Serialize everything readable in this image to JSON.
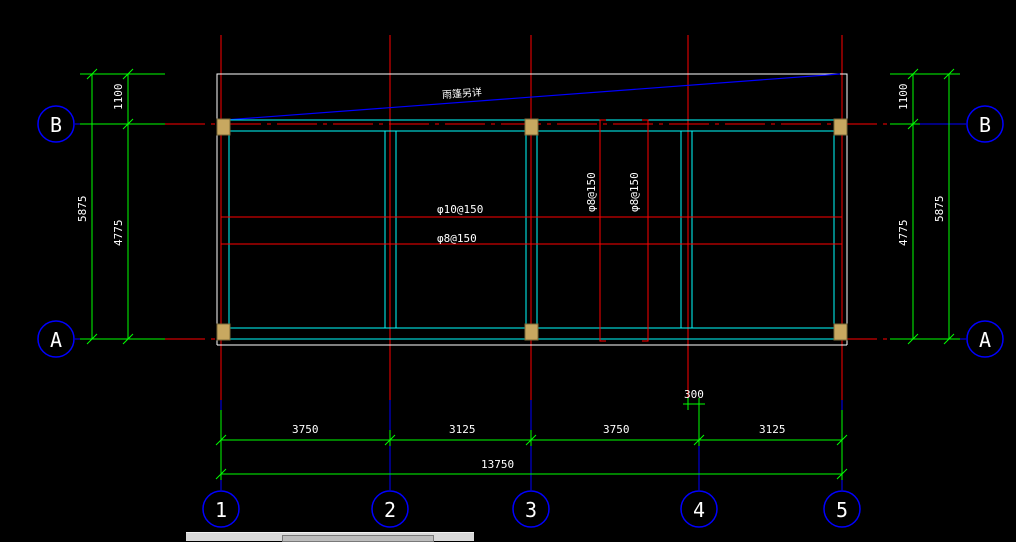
{
  "colors": {
    "background": "#000000",
    "axis_line": "#ff0000",
    "dimension": "#00ff00",
    "beam": "#00ffff",
    "column": "#c8a860",
    "bubble": "#0000ff",
    "canopy_line": "#0000ff",
    "outline": "#ffffff",
    "text": "#ffffff"
  },
  "axes": {
    "vertical": [
      {
        "id": "1",
        "label": "1"
      },
      {
        "id": "2",
        "label": "2"
      },
      {
        "id": "3",
        "label": "3"
      },
      {
        "id": "4",
        "label": "4"
      },
      {
        "id": "5",
        "label": "5"
      }
    ],
    "horizontal": [
      {
        "id": "B",
        "label": "B"
      },
      {
        "id": "A",
        "label": "A"
      }
    ]
  },
  "dimensions": {
    "bays": [
      "3750",
      "3125",
      "3750",
      "3125"
    ],
    "total": "13750",
    "offset": "300",
    "left_outer": "5875",
    "left_inner": "4775",
    "left_top": "1100",
    "right_outer": "5875",
    "right_inner": "4775",
    "right_top": "1100"
  },
  "annotations": {
    "canopy": "雨篷另详",
    "rebar_horizontal_top": "φ10@150",
    "rebar_horizontal_bottom": "φ8@150",
    "rebar_vertical_left": "φ8@150",
    "rebar_vertical_right": "φ8@150"
  },
  "status_bar": {}
}
